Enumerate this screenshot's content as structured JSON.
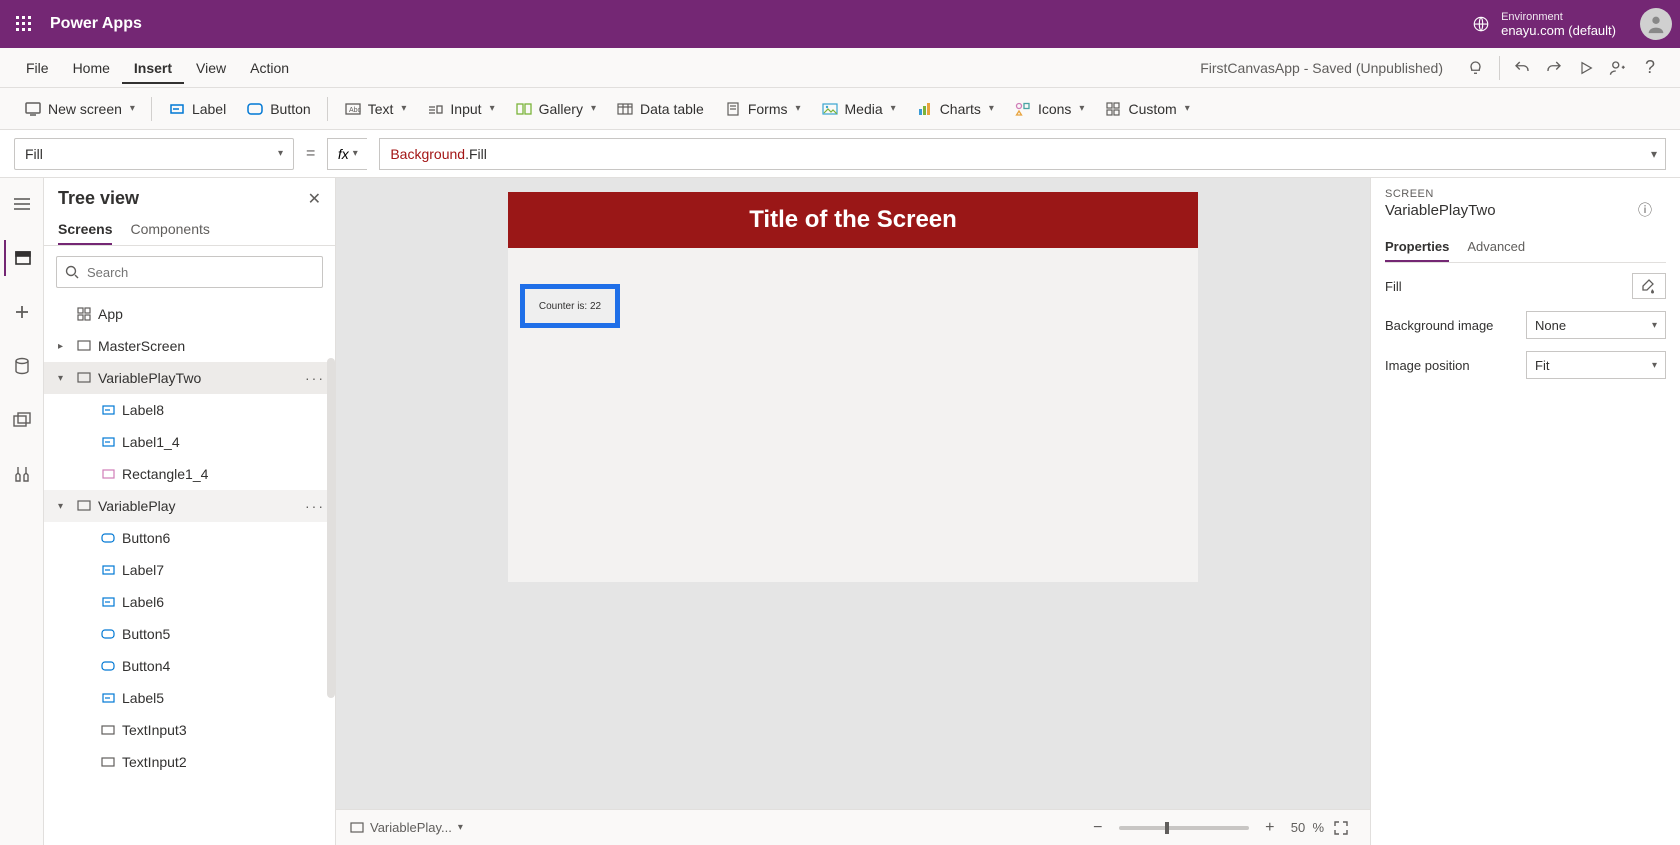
{
  "topbar": {
    "app_title": "Power Apps",
    "env_label": "Environment",
    "env_name": "enayu.com (default)"
  },
  "menurow": {
    "items": [
      "File",
      "Home",
      "Insert",
      "View",
      "Action"
    ],
    "active_index": 2,
    "doc_status": "FirstCanvasApp - Saved (Unpublished)"
  },
  "ribbon": {
    "new_screen": "New screen",
    "label": "Label",
    "button": "Button",
    "text": "Text",
    "input": "Input",
    "gallery": "Gallery",
    "data_table": "Data table",
    "forms": "Forms",
    "media": "Media",
    "charts": "Charts",
    "icons": "Icons",
    "custom": "Custom"
  },
  "formulabar": {
    "property": "Fill",
    "fx": "fx",
    "formula_ident": "Background",
    "formula_prop": ".Fill"
  },
  "tree": {
    "title": "Tree view",
    "tabs": [
      "Screens",
      "Components"
    ],
    "active_tab": 0,
    "search_placeholder": "Search",
    "app_label": "App",
    "items": [
      {
        "label": "MasterScreen"
      },
      {
        "label": "VariablePlayTwo"
      },
      {
        "label": "Label8"
      },
      {
        "label": "Label1_4"
      },
      {
        "label": "Rectangle1_4"
      },
      {
        "label": "VariablePlay"
      },
      {
        "label": "Button6"
      },
      {
        "label": "Label7"
      },
      {
        "label": "Label6"
      },
      {
        "label": "Button5"
      },
      {
        "label": "Button4"
      },
      {
        "label": "Label5"
      },
      {
        "label": "TextInput3"
      },
      {
        "label": "TextInput2"
      }
    ]
  },
  "canvas": {
    "screen_title": "Title of the Screen",
    "counter_text": "Counter is: 22"
  },
  "bottom": {
    "crumb": "VariablePlay...",
    "zoom_value": "50",
    "zoom_pct": "%"
  },
  "proppanel": {
    "kind": "SCREEN",
    "name": "VariablePlayTwo",
    "tabs": [
      "Properties",
      "Advanced"
    ],
    "active_tab": 0,
    "rows": {
      "fill_label": "Fill",
      "bgimage_label": "Background image",
      "bgimage_value": "None",
      "imgpos_label": "Image position",
      "imgpos_value": "Fit"
    }
  }
}
